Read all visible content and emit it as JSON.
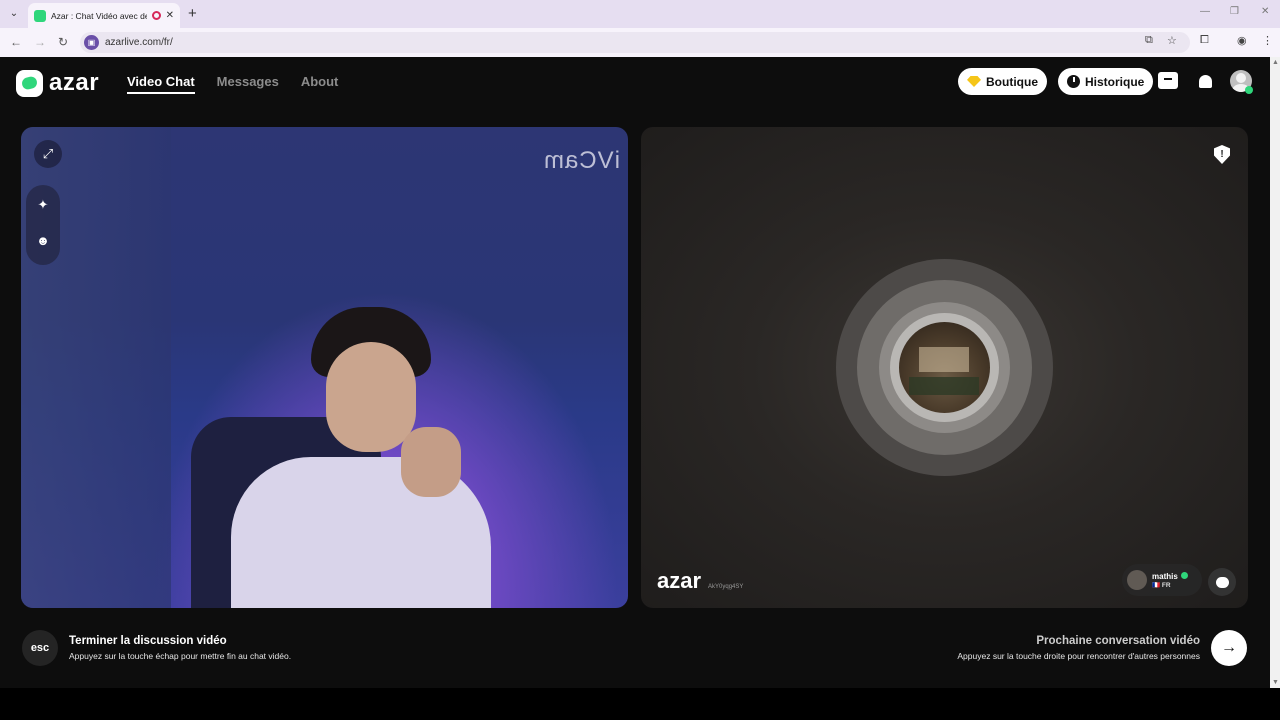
{
  "browser": {
    "tab_title": "Azar : Chat Vidéo avec de n",
    "url": "azarlive.com/fr/",
    "new_tab": "+",
    "tab_close": "✕"
  },
  "header": {
    "logo_text": "azar",
    "nav": [
      {
        "label": "Video Chat",
        "active": true
      },
      {
        "label": "Messages",
        "active": false
      },
      {
        "label": "About",
        "active": false
      }
    ],
    "boutique_label": "Boutique",
    "historique_label": "Historique"
  },
  "local_video": {
    "watermark": "iVCam"
  },
  "remote_video": {
    "shield_symbol": "!",
    "watermark_brand": "azar",
    "watermark_id": "AkY0yqg4SY",
    "peer_name": "mathis",
    "peer_country": "🇫🇷 FR"
  },
  "footer": {
    "esc_key": "esc",
    "end_title": "Terminer la discussion vidéo",
    "end_sub": "Appuyez sur la touche échap pour mettre fin au chat vidéo.",
    "next_title": "Prochaine conversation vidéo",
    "next_sub": "Appuyez sur la touche droite pour rencontrer d'autres personnes",
    "next_arrow": "→"
  },
  "colors": {
    "brand_green": "#2fd67b",
    "background": "#0d0d0d"
  }
}
